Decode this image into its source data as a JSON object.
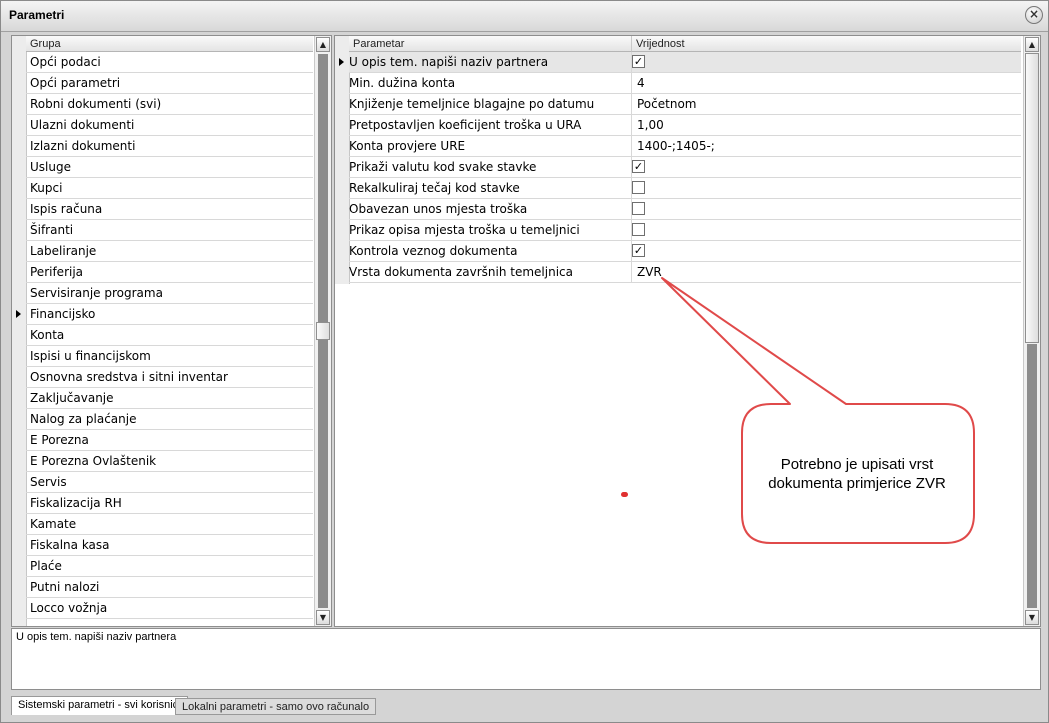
{
  "window": {
    "title": "Parametri"
  },
  "groups": {
    "header": "Grupa",
    "items": [
      "Opći podaci",
      "Opći parametri",
      "Robni dokumenti (svi)",
      "Ulazni dokumenti",
      "Izlazni dokumenti",
      "Usluge",
      "Kupci",
      "Ispis računa",
      "Šifranti",
      "Labeliranje",
      "Periferija",
      "Servisiranje programa",
      "Financijsko",
      "Konta",
      "Ispisi u financijskom",
      "Osnovna sredstva i sitni inventar",
      "Zaključavanje",
      "Nalog za plaćanje",
      "E Porezna",
      "E Porezna Ovlaštenik",
      "Servis",
      "Fiskalizacija RH",
      "Kamate",
      "Fiskalna kasa",
      "Plaće",
      "Putni nalozi",
      "Locco vožnja"
    ],
    "selected_index": 12
  },
  "params": {
    "header_name": "Parametar",
    "header_value": "Vrijednost",
    "selected_index": 0,
    "rows": [
      {
        "name": "U opis tem. napiši naziv partnera",
        "type": "checkbox",
        "checked": true
      },
      {
        "name": "Min. dužina konta",
        "type": "text",
        "value": "4"
      },
      {
        "name": "Knjiženje temeljnice blagajne po datumu",
        "type": "text",
        "value": "Početnom"
      },
      {
        "name": "Pretpostavljen koeficijent troška u URA",
        "type": "text",
        "value": "1,00"
      },
      {
        "name": "Konta provjere URE",
        "type": "text",
        "value": "1400-;1405-;"
      },
      {
        "name": "Prikaži valutu kod svake stavke",
        "type": "checkbox",
        "checked": true
      },
      {
        "name": "Rekalkuliraj tečaj kod stavke",
        "type": "checkbox",
        "checked": false
      },
      {
        "name": "Obavezan unos mjesta troška",
        "type": "checkbox",
        "checked": false
      },
      {
        "name": "Prikaz opisa mjesta troška u temeljnici",
        "type": "checkbox",
        "checked": false
      },
      {
        "name": "Kontrola veznog dokumenta",
        "type": "checkbox",
        "checked": true
      },
      {
        "name": "Vrsta dokumenta završnih temeljnica",
        "type": "text",
        "value": "ZVR"
      }
    ]
  },
  "description": "U opis tem. napiši naziv partnera",
  "tabs": [
    "Sistemski parametri - svi korisnici",
    "Lokalni parametri - samo ovo računalo"
  ],
  "callout": {
    "line1": "Potrebno je upisati vrst",
    "line2": "dokumenta primjerice ZVR",
    "color": "#e04a4a"
  }
}
